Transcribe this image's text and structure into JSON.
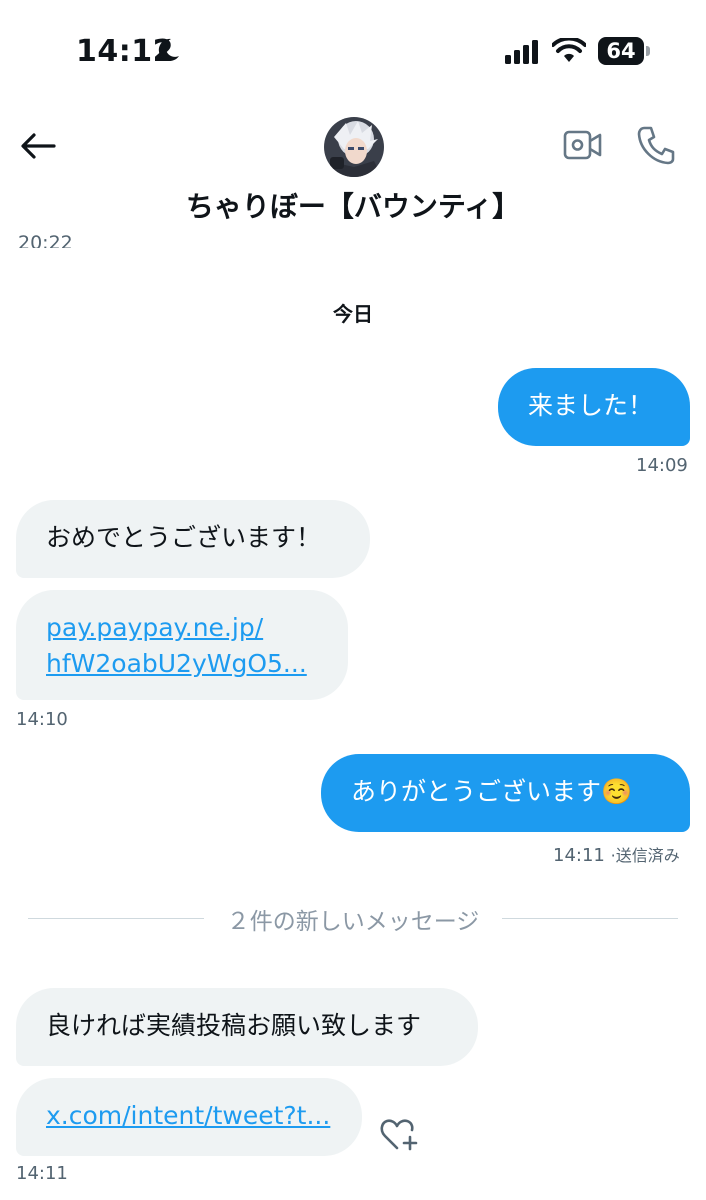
{
  "status_bar": {
    "time": "14:12",
    "battery": "64"
  },
  "header": {
    "contact_name": "ちゃりぼー【バウンティ】"
  },
  "prev_timestamp": "20:22",
  "day_label": "今日",
  "messages": [
    {
      "text": "来ました！",
      "time": "14:09"
    },
    {
      "text": "おめでとうございます！"
    },
    {
      "link_line1": "pay.paypay.ne.jp/",
      "link_line2": "hfW2oabU2yWgO5...",
      "time": "14:10"
    },
    {
      "text": "ありがとうございます☺️",
      "time": "14:11",
      "status": "·送信済み"
    },
    {
      "text": "良ければ実績投稿お願い致します"
    },
    {
      "link": "x.com/intent/tweet?t...",
      "time": "14:11"
    }
  ],
  "new_messages_divider": "２件の新しいメッセージ",
  "colors": {
    "accent": "#1d9bf0",
    "bubble_in": "#eff3f4",
    "text": "#0f1419",
    "muted": "#536471"
  }
}
